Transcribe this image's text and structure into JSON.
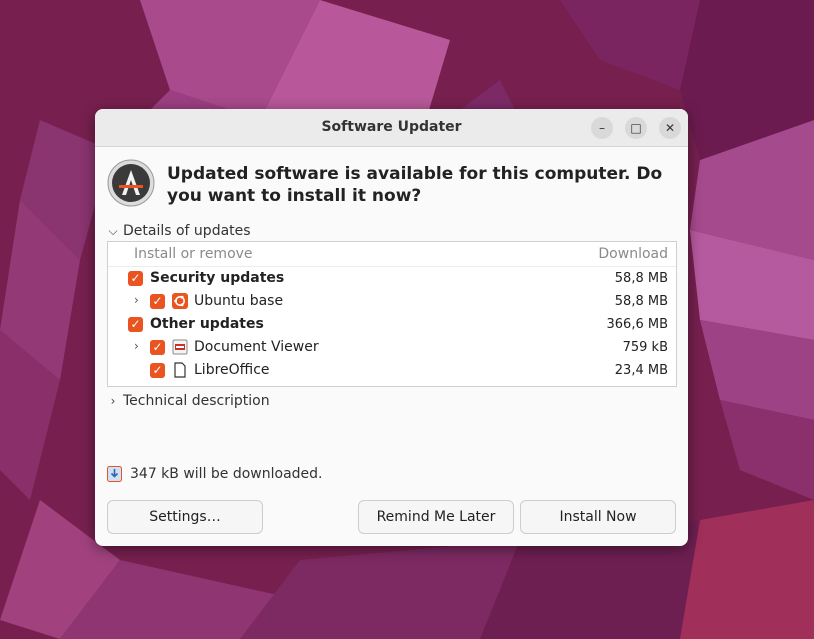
{
  "window": {
    "title": "Software Updater",
    "controls": {
      "minimize": "–",
      "maximize": "□",
      "close": "✕"
    }
  },
  "headline": "Updated software is available for this computer. Do you want to install it now?",
  "details": {
    "expander_label": "Details of updates",
    "columns": {
      "name": "Install or remove",
      "size": "Download"
    },
    "rows": [
      {
        "label": "Security updates",
        "size": "58,8 MB",
        "checked": true,
        "group": true
      },
      {
        "label": "Ubuntu base",
        "size": "58,8 MB",
        "checked": true,
        "icon": "ubuntu-logo-icon"
      },
      {
        "label": "Other updates",
        "size": "366,6 MB",
        "checked": true,
        "group": true
      },
      {
        "label": "Document Viewer",
        "size": "759 kB",
        "checked": true,
        "icon": "document-viewer-icon"
      },
      {
        "label": "LibreOffice",
        "size": "23,4 MB",
        "checked": true,
        "icon": "document-icon"
      }
    ]
  },
  "technical": {
    "expander_label": "Technical description"
  },
  "download_info": "347 kB will be downloaded.",
  "buttons": {
    "settings": "Settings…",
    "remind": "Remind Me Later",
    "install": "Install Now"
  },
  "colors": {
    "accent": "#e95420",
    "wallpaper": "#7e2258"
  }
}
